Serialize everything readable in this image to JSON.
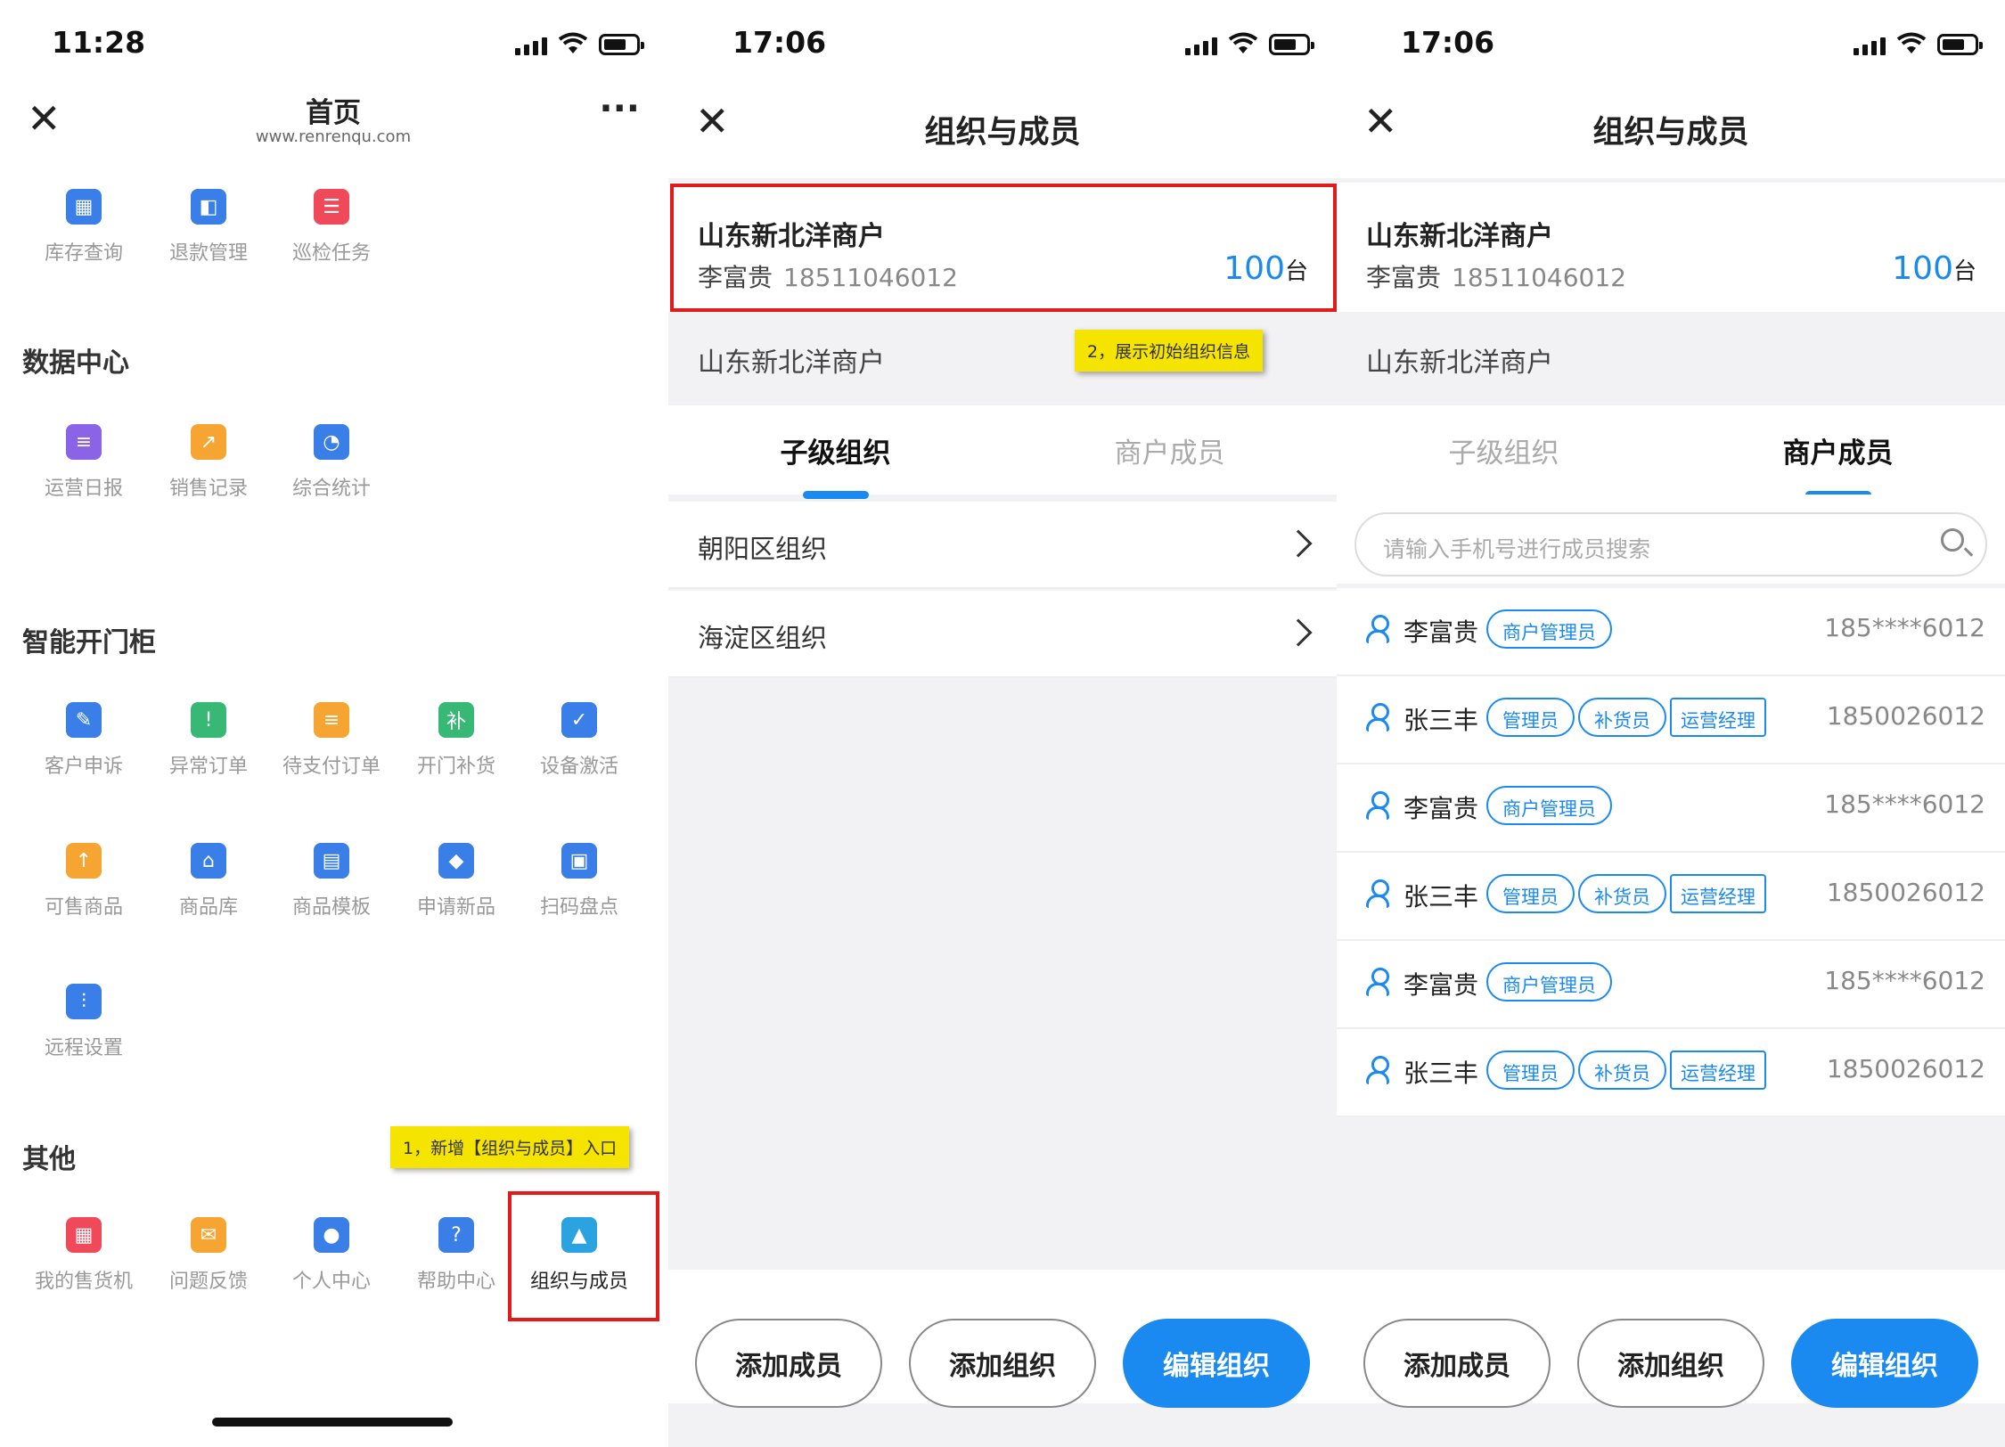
{
  "screen1": {
    "time": "11:28",
    "title": "首页",
    "subtitle": "www.renrenqu.com",
    "more_label": "···",
    "top_items": [
      {
        "label": "库存查询",
        "icon": "inventory-icon",
        "color": "#3a7ee8"
      },
      {
        "label": "退款管理",
        "icon": "wallet-icon",
        "color": "#3a7ee8"
      },
      {
        "label": "巡检任务",
        "icon": "checklist-icon",
        "color": "#f04a5a"
      }
    ],
    "section_data": "数据中心",
    "data_items": [
      {
        "label": "运营日报",
        "icon": "report-icon",
        "color": "#8a63e6"
      },
      {
        "label": "销售记录",
        "icon": "sales-chart-icon",
        "color": "#f6a532"
      },
      {
        "label": "综合统计",
        "icon": "pie-chart-icon",
        "color": "#3a7ee8"
      }
    ],
    "section_cabinet": "智能开门柜",
    "cabinet_items": [
      {
        "label": "客户申诉",
        "icon": "complaint-icon",
        "color": "#3a7ee8"
      },
      {
        "label": "异常订单",
        "icon": "abnormal-order-icon",
        "color": "#37b874"
      },
      {
        "label": "待支付订单",
        "icon": "pending-order-icon",
        "color": "#f6a532"
      },
      {
        "label": "开门补货",
        "icon": "restock-icon",
        "color": "#37b874"
      },
      {
        "label": "设备激活",
        "icon": "device-activate-icon",
        "color": "#3a7ee8"
      },
      {
        "label": "可售商品",
        "icon": "sale-goods-icon",
        "color": "#f6a532"
      },
      {
        "label": "商品库",
        "icon": "warehouse-icon",
        "color": "#3a7ee8"
      },
      {
        "label": "商品模板",
        "icon": "template-icon",
        "color": "#3a7ee8"
      },
      {
        "label": "申请新品",
        "icon": "new-product-icon",
        "color": "#3a7ee8"
      },
      {
        "label": "扫码盘点",
        "icon": "scan-icon",
        "color": "#3a7ee8"
      },
      {
        "label": "远程设置",
        "icon": "sliders-icon",
        "color": "#3a7ee8"
      }
    ],
    "section_other": "其他",
    "other_items": [
      {
        "label": "我的售货机",
        "icon": "vending-machine-icon",
        "color": "#f04a5a"
      },
      {
        "label": "问题反馈",
        "icon": "feedback-icon",
        "color": "#f6a532"
      },
      {
        "label": "个人中心",
        "icon": "person-icon",
        "color": "#3a7ee8"
      },
      {
        "label": "帮助中心",
        "icon": "help-icon",
        "color": "#3a7ee8"
      },
      {
        "label": "组织与成员",
        "icon": "image-icon",
        "color": "#2aa3e0"
      }
    ],
    "note": "1，新增【组织与成员】入口"
  },
  "screen2": {
    "time": "17:06",
    "title": "组织与成员",
    "org_name": "山东新北洋商户",
    "person": "李富贵",
    "person_phone": "18511046012",
    "count": "100",
    "count_unit": "台",
    "crumb": "山东新北洋商户",
    "note": "2，展示初始组织信息",
    "tab_sub": "子级组织",
    "tab_members": "商户成员",
    "rows": [
      "朝阳区组织",
      "海淀区组织"
    ],
    "btn_add_member": "添加成员",
    "btn_add_org": "添加组织",
    "btn_edit_org": "编辑组织"
  },
  "screen3": {
    "time": "17:06",
    "title": "组织与成员",
    "org_name": "山东新北洋商户",
    "person": "李富贵",
    "person_phone": "18511046012",
    "count": "100",
    "count_unit": "台",
    "crumb": "山东新北洋商户",
    "tab_sub": "子级组织",
    "tab_members": "商户成员",
    "search_placeholder": "请输入手机号进行成员搜索",
    "members": [
      {
        "name": "李富贵",
        "tags": [
          "商户管理员"
        ],
        "phone": "185****6012"
      },
      {
        "name": "张三丰",
        "tags": [
          "管理员",
          "补货员",
          "运营经理"
        ],
        "phone": "1850026012"
      },
      {
        "name": "李富贵",
        "tags": [
          "商户管理员"
        ],
        "phone": "185****6012"
      },
      {
        "name": "张三丰",
        "tags": [
          "管理员",
          "补货员",
          "运营经理"
        ],
        "phone": "1850026012"
      },
      {
        "name": "李富贵",
        "tags": [
          "商户管理员"
        ],
        "phone": "185****6012"
      },
      {
        "name": "张三丰",
        "tags": [
          "管理员",
          "补货员",
          "运营经理"
        ],
        "phone": "1850026012"
      }
    ],
    "btn_add_member": "添加成员",
    "btn_add_org": "添加组织",
    "btn_edit_org": "编辑组织"
  }
}
